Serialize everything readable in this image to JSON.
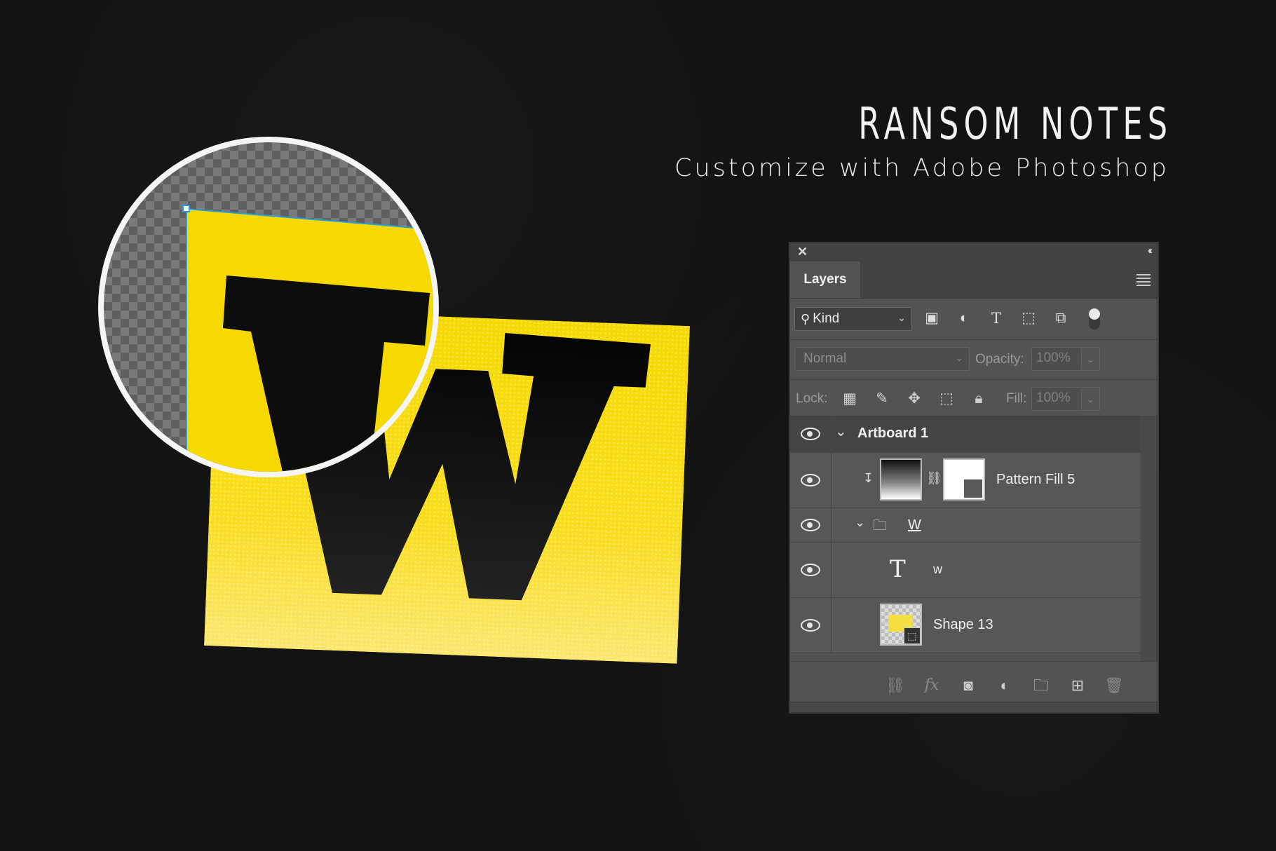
{
  "header": {
    "title": "RANSOM NOTES",
    "subtitle": "Customize with Adobe Photoshop"
  },
  "artwork": {
    "letter": "W",
    "sticker_color": "#f6d900",
    "letter_color": "#0d0d0d"
  },
  "panel": {
    "tab_label": "Layers",
    "filter": {
      "kind_label": "Kind",
      "icons": [
        "image-filter-icon",
        "adjustment-filter-icon",
        "type-filter-icon",
        "shape-filter-icon",
        "smart-object-filter-icon"
      ]
    },
    "blend_mode": "Normal",
    "opacity_label": "Opacity:",
    "opacity_value": "100%",
    "lock_label": "Lock:",
    "fill_label": "Fill:",
    "fill_value": "100%",
    "layers": [
      {
        "name": "Artboard 1"
      },
      {
        "name": "Pattern Fill 5"
      },
      {
        "name": "W"
      },
      {
        "name": "w"
      },
      {
        "name": "Shape 13"
      }
    ]
  }
}
